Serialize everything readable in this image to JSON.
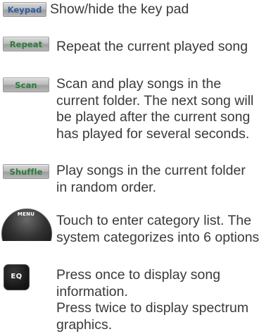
{
  "items": [
    {
      "button_label": "Keypad",
      "icon": "keypad-button",
      "lines": [
        "Show/hide the key pad"
      ]
    },
    {
      "button_label": "Repeat",
      "icon": "repeat-button",
      "lines": [
        "Repeat the current played song"
      ]
    },
    {
      "button_label": "Scan",
      "icon": "scan-button",
      "lines": [
        "Scan and play songs in the",
        "current folder.  The next song will",
        "be played after the current song",
        "has played for several seconds."
      ]
    },
    {
      "button_label": "Shuffle",
      "icon": "shuffle-button",
      "lines": [
        "Play songs in the current folder",
        "in random order."
      ]
    },
    {
      "button_label": "MENU",
      "icon": "menu-button",
      "lines": [
        "Touch to enter category list.  The",
        "system categorizes into 6 options"
      ]
    },
    {
      "button_label": "EQ",
      "icon": "eq-button",
      "lines": [
        "Press once to display song",
        "information.",
        "Press twice to display spectrum",
        "graphics."
      ]
    }
  ],
  "colors": {
    "text": "#3a3a3a",
    "keypad_label": "#2f5fa0",
    "green_label": "#2c7d3a",
    "dark_button": "#1a1a1a"
  }
}
